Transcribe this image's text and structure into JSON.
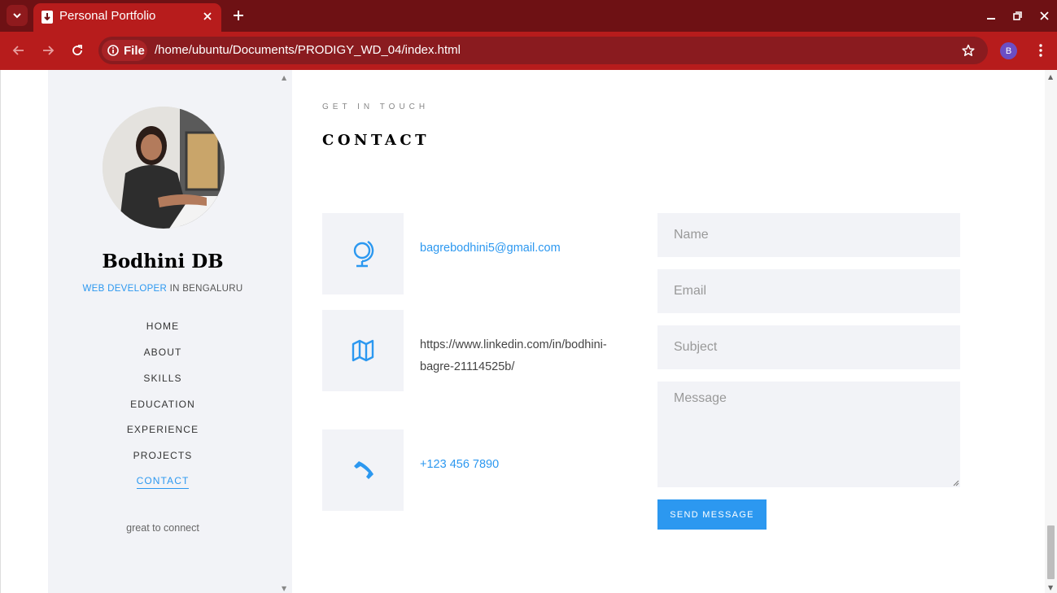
{
  "browser": {
    "tab_title": "Personal Portfolio",
    "url_chip": "File",
    "url": "/home/ubuntu/Documents/PRODIGY_WD_04/index.html",
    "profile_initial": "B",
    "theme_color": "#b71c1c"
  },
  "sidebar": {
    "name": "Bodhini DB",
    "role_accent": "WEB DEVELOPER",
    "role_rest": " IN BENGALURU",
    "nav": [
      {
        "label": "HOME"
      },
      {
        "label": "ABOUT"
      },
      {
        "label": "SKILLS"
      },
      {
        "label": "EDUCATION"
      },
      {
        "label": "EXPERIENCE"
      },
      {
        "label": "PROJECTS"
      },
      {
        "label": "CONTACT",
        "active": true
      }
    ],
    "tagline": "great to connect"
  },
  "contact": {
    "eyebrow": "GET IN TOUCH",
    "heading": "CONTACT",
    "items": [
      {
        "icon": "globe-icon",
        "text": "bagrebodhini5@gmail.com"
      },
      {
        "icon": "map-icon",
        "text": "https://www.linkedin.com/in/bodhini-bagre-21114525b/"
      },
      {
        "icon": "phone-icon",
        "text": "+123 456 7890"
      }
    ],
    "form": {
      "name_placeholder": "Name",
      "email_placeholder": "Email",
      "subject_placeholder": "Subject",
      "message_placeholder": "Message",
      "send_label": "SEND MESSAGE"
    },
    "accent_color": "#2c98f0"
  }
}
